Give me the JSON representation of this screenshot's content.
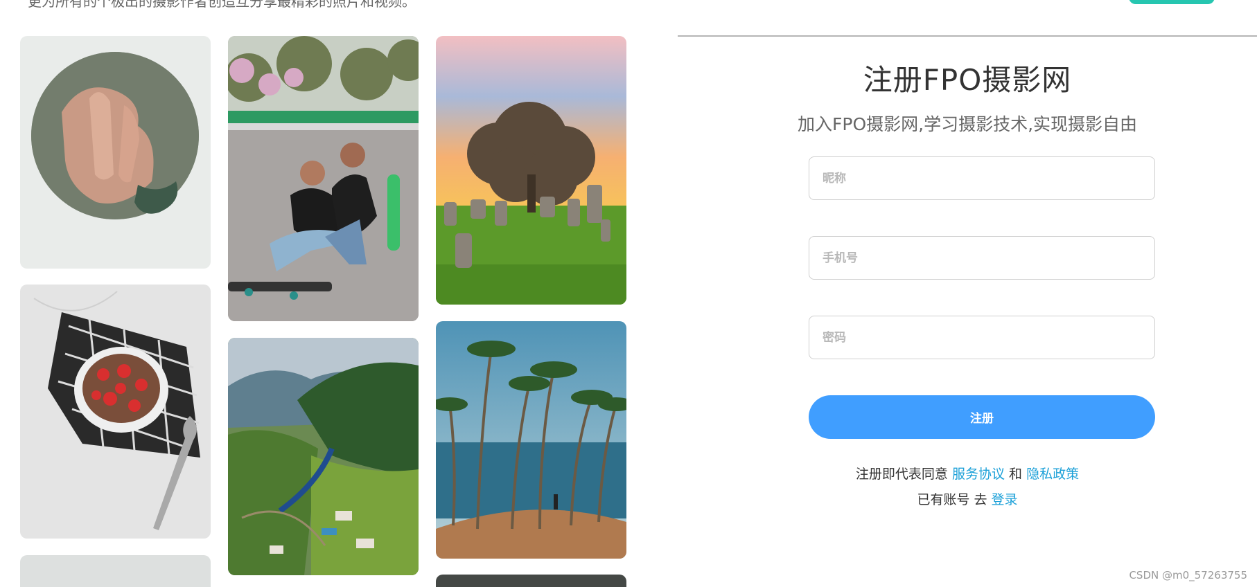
{
  "header": {
    "tagline": "更为所有的个极出的摄影作者创造互分享最精彩的照片和视频。"
  },
  "form": {
    "title": "注册FPO摄影网",
    "subtitle": "加入FPO摄影网,学习摄影技术,实现摄影自由",
    "nickname_placeholder": "昵称",
    "phone_placeholder": "手机号",
    "password_placeholder": "密码",
    "submit_label": "注册",
    "agree_prefix": "注册即代表同意",
    "service_link": "服务协议",
    "agree_and": "和",
    "privacy_link": "隐私政策",
    "login_prefix": "已有账号 去",
    "login_link": "登录"
  },
  "watermark": "CSDN @m0_57263755",
  "colors": {
    "primary_button": "#409eff",
    "link": "#1ba0d8",
    "top_accent": "#26c6b0"
  },
  "gallery": [
    "hands-in-circle-photo",
    "couple-skateboard-photo",
    "sunset-tree-stones-photo",
    "strawberry-bowl-photo",
    "train-valley-photo",
    "palm-trees-coast-photo",
    "partial-photo-bottom-left",
    "partial-photo-bottom-right"
  ]
}
